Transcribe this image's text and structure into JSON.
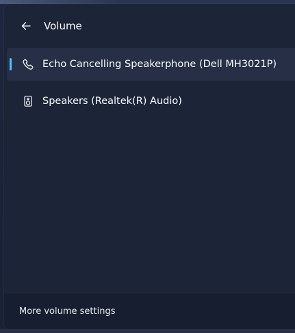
{
  "header": {
    "back_icon": "arrow-left-icon",
    "title": "Volume"
  },
  "devices": [
    {
      "label": "Echo Cancelling Speakerphone (Dell MH3021P)",
      "icon": "phone-icon",
      "selected": true
    },
    {
      "label": "Speakers (Realtek(R) Audio)",
      "icon": "speaker-icon",
      "selected": false
    }
  ],
  "footer": {
    "more_settings_label": "More volume settings"
  },
  "colors": {
    "accent": "#4cc2ff",
    "panel_background": "#1c2438",
    "selected_row": "#262f45",
    "footer_background": "#171e30"
  }
}
